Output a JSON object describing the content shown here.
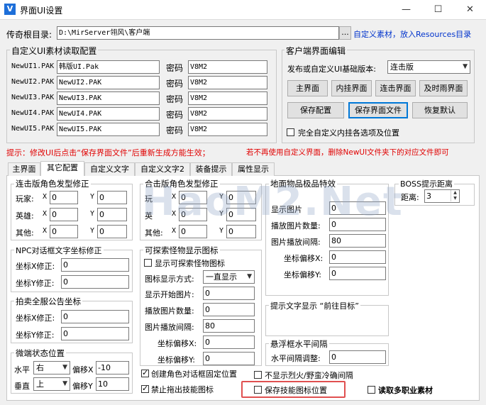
{
  "window": {
    "title": "界面UI设置",
    "icon_letter": "V",
    "minimize": "—",
    "maximize": "☐",
    "close": "✕"
  },
  "root": {
    "label": "传奇根目录:",
    "path": "D:\\MirServer翎风\\客户端",
    "browse": "...",
    "hint": "自定义素材，放入Resources目录"
  },
  "custom_ui": {
    "title": "自定义UI素材读取配置",
    "password_label": "密码",
    "rows": [
      {
        "label": "NewUI1.PAK",
        "file": "韩版UI.Pak",
        "pwd": "V8M2"
      },
      {
        "label": "NewUI2.PAK",
        "file": "NewUI2.PAK",
        "pwd": "V8M2"
      },
      {
        "label": "NewUI3.PAK",
        "file": "NewUI3.PAK",
        "pwd": "V8M2"
      },
      {
        "label": "NewUI4.PAK",
        "file": "NewUI4.PAK",
        "pwd": "V8M2"
      },
      {
        "label": "NewUI5.PAK",
        "file": "NewUI5.PAK",
        "pwd": "V8M2"
      }
    ]
  },
  "client_ui": {
    "title": "客户端界面编辑",
    "version_label": "发布或自定义UI基础版本:",
    "version_value": "连击版",
    "btn_main": "主界面",
    "btn_inner": "内挂界面",
    "btn_combo": "连击界面",
    "btn_rain": "及时雨界面",
    "btn_save_cfg": "保存配置",
    "btn_save_file": "保存界面文件",
    "btn_restore": "恢复默认",
    "chk_full": "完全自定义内挂各选项及位置"
  },
  "tip": {
    "left": "提示：修改UI后点击“保存界面文件”后重新生成方能生效；",
    "right": "若不再使用自定义界面，删除NewUI文件夹下的对应文件即可"
  },
  "tabs": [
    "主界面",
    "其它配置",
    "自定义文字",
    "自定义文字2",
    "装备提示",
    "属性显示"
  ],
  "hair_fix": {
    "title": "连击版角色发型修正",
    "rows": [
      {
        "label": "玩家:",
        "x": "0",
        "y": "0"
      },
      {
        "label": "英雄:",
        "x": "0",
        "y": "0"
      },
      {
        "label": "其他:",
        "x": "0",
        "y": "0"
      }
    ],
    "x_label": "X",
    "y_label": "Y"
  },
  "hair_fix2": {
    "title": "合击版角色发型修正",
    "rows": [
      {
        "label": "玩",
        "x": "0",
        "y": "0"
      },
      {
        "label": "英",
        "x": "0",
        "y": "0"
      },
      {
        "label": "其他:",
        "x": "0",
        "y": "0"
      }
    ],
    "x_label": "X",
    "y_label": "Y"
  },
  "npc_fix": {
    "title": "NPC对话框文字坐标修正",
    "x_label": "坐标X修正:",
    "x": "0",
    "y_label": "坐标Y修正:",
    "y": "0"
  },
  "auction": {
    "title": "拍卖全服公告坐标",
    "x_label": "坐标X修正:",
    "x": "0",
    "y_label": "坐标Y修正:",
    "y": "0"
  },
  "micro": {
    "title": "微端状态位置",
    "h_label": "水平",
    "h_value": "右",
    "offx_label": "偏移X",
    "offx": "-10",
    "v_label": "垂直",
    "v_value": "上",
    "offy_label": "偏移Y",
    "offy": "10"
  },
  "explore": {
    "title": "可探索怪物显示图标",
    "chk": "显示可探索怪物图标",
    "mode_label": "图标显示方式:",
    "mode_value": "一直显示",
    "start_label": "显示开始图片:",
    "start": "0",
    "count_label": "播放图片数量:",
    "count": "0",
    "interval_label": "图片播放间隔:",
    "interval": "80",
    "offx_label": "坐标偏移X:",
    "offx": "0",
    "offy_label": "坐标偏移Y:",
    "offy": "0"
  },
  "ground": {
    "title": "地面物品极品特效",
    "start_label": "显示图片",
    "start": "0",
    "count_label": "播放图片数量:",
    "count": "0",
    "interval_label": "图片播放间隔:",
    "interval": "80",
    "offx_label": "坐标偏移X:",
    "offx": "0",
    "offy_label": "坐标偏移Y:",
    "offy": "0"
  },
  "boss": {
    "title": "BOSS提示距离",
    "label": "距离:",
    "value": "3"
  },
  "hint_text": {
    "title": "提示文字显示 “前往目标”"
  },
  "float_box": {
    "title": "悬浮框水平间隔",
    "label": "水平间隔调整:",
    "value": "0"
  },
  "bottom": {
    "chk_npc_fix": "创建角色对话框固定位置",
    "chk_no_drag": "禁止拖出技能图标",
    "chk_no_show": "不显示烈火/野蛮冷确间隔",
    "chk_save_skill": "保存技能图标位置",
    "chk_multi": "读取多职业素材"
  },
  "watermark": "HaoM2.Net"
}
